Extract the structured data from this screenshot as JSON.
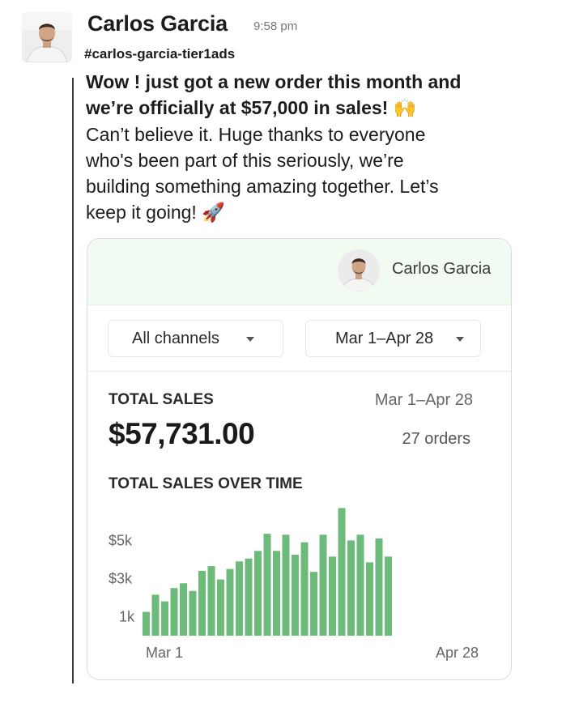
{
  "message": {
    "author": "Carlos Garcia",
    "time": "9:58 pm",
    "channel": "#carlos-garcia-tier1ads",
    "lines": [
      "Wow !  just got a new order this month and",
      "we’re officially at $57,000 in sales!",
      " Can’t believe it. Huge thanks to everyone",
      "who's been part of this seriously, we’re",
      "building something amazing together. Let’s",
      "keep it going!"
    ],
    "emoji_hands": "🙌",
    "emoji_rocket": "🚀"
  },
  "card": {
    "user_name": "Carlos Garcia",
    "channel_filter": "All channels",
    "date_filter": "Mar 1–Apr 28",
    "total_label": "TOTAL SALES",
    "total_range": "Mar 1–Apr 28",
    "total_value": "$57,731.00",
    "orders": "27 orders",
    "over_time_label": "TOTAL SALES OVER TIME"
  },
  "colors": {
    "bar": "#6dbb7b",
    "header_bg": "#f2fbf2"
  },
  "chart_data": {
    "type": "bar",
    "title": "TOTAL SALES OVER TIME",
    "y_tick_labels": [
      "$5k",
      "$3k",
      "1k"
    ],
    "y_tick_values": [
      5000,
      3000,
      1000
    ],
    "x_tick_labels": [
      "Mar 1",
      "Apr 28"
    ],
    "ylim": [
      0,
      6800
    ],
    "grid": false,
    "series": [
      {
        "values": [
          1250,
          2150,
          1800,
          2500,
          2750,
          2350,
          3400,
          3650,
          2950,
          3500,
          3900,
          4050,
          4450,
          5350,
          4450,
          5300,
          4250,
          4900,
          3350,
          5300,
          4150,
          6700,
          5000,
          5300,
          3850,
          5100,
          4150
        ]
      }
    ]
  }
}
